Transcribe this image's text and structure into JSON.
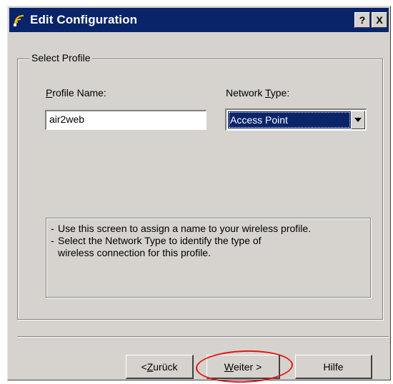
{
  "window": {
    "title": "Edit Configuration",
    "help_button": "?",
    "close_button": "X"
  },
  "group": {
    "legend": "Select Profile"
  },
  "profile_name": {
    "label_first": "P",
    "label_rest": "rofile Name:",
    "value": "air2web"
  },
  "network_type": {
    "label_pre": "Network ",
    "label_mnemonic": "T",
    "label_rest": "ype:",
    "selected": "Access Point"
  },
  "help_text": {
    "line1": "Use this screen to assign a name to your wireless profile.",
    "line2": "Select the Network Type to identify the type of",
    "line3": "wireless connection for this profile."
  },
  "buttons": {
    "back_pre": "< ",
    "back_mnemonic": "Z",
    "back_rest": "urück",
    "next_mnemonic": "W",
    "next_rest": "eiter >",
    "help": "Hilfe"
  },
  "colors": {
    "title_bar": "#0a246a",
    "highlight_circle": "#e01818"
  }
}
